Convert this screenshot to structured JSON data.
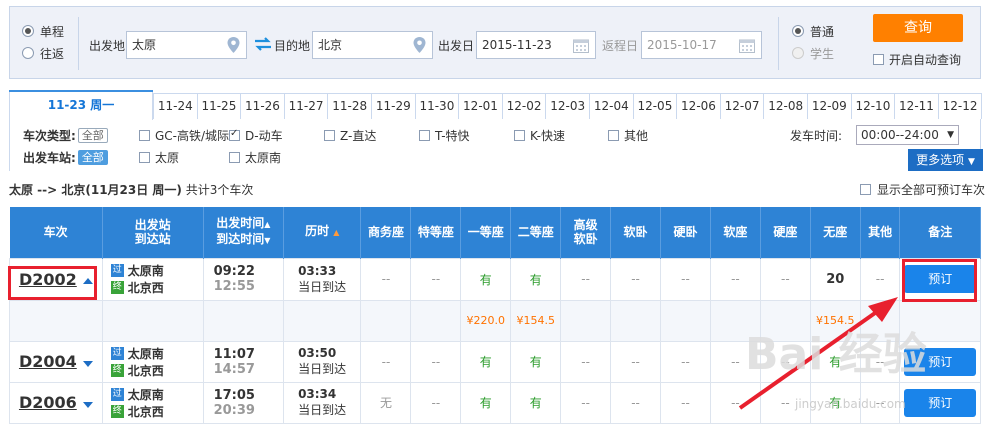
{
  "search": {
    "trip_types": [
      {
        "label": "单程",
        "checked": true
      },
      {
        "label": "往返",
        "checked": false
      }
    ],
    "from_label": "出发地",
    "from_value": "太原",
    "to_label": "目的地",
    "to_value": "北京",
    "depart_label": "出发日",
    "depart_value": "2015-11-23",
    "return_label": "返程日",
    "return_value": "2015-10-17",
    "passenger_types": [
      {
        "label": "普通",
        "checked": true
      },
      {
        "label": "学生",
        "checked": false
      }
    ],
    "query_label": "查询",
    "auto_query_label": "开启自动查询"
  },
  "dates": {
    "active": "11-23 周一",
    "tabs": [
      "11-24",
      "11-25",
      "11-26",
      "11-27",
      "11-28",
      "11-29",
      "11-30",
      "12-01",
      "12-02",
      "12-03",
      "12-04",
      "12-05",
      "12-06",
      "12-07",
      "12-08",
      "12-09",
      "12-10",
      "12-11",
      "12-12"
    ]
  },
  "filters": {
    "type_label": "车次类型:",
    "all_label": "全部",
    "types": [
      {
        "label": "GC-高铁/城际",
        "checked": false
      },
      {
        "label": "D-动车",
        "checked": true
      },
      {
        "label": "Z-直达",
        "checked": false
      },
      {
        "label": "T-特快",
        "checked": false
      },
      {
        "label": "K-快速",
        "checked": false
      },
      {
        "label": "其他",
        "checked": false
      }
    ],
    "station_label": "出发车站:",
    "stations": [
      {
        "label": "太原",
        "checked": false
      },
      {
        "label": "太原南",
        "checked": false
      }
    ],
    "time_label": "发车时间:",
    "time_value": "00:00--24:00",
    "more_label": "更多选项"
  },
  "summary": {
    "route": "太原 --> 北京",
    "date": "(11月23日  周一)",
    "count_text": "共计3个车次",
    "show_all_label": "显示全部可预订车次"
  },
  "table": {
    "headers": {
      "train": "车次",
      "station_1": "出发站",
      "station_2": "到达站",
      "time_1": "出发时间",
      "time_2": "到达时间",
      "duration": "历时",
      "business": "商务座",
      "special": "特等座",
      "first": "一等座",
      "second": "二等座",
      "senior_1": "高级",
      "senior_2": "软卧",
      "soft_sleeper": "软卧",
      "hard_sleeper": "硬卧",
      "soft_seat": "软座",
      "hard_seat": "硬座",
      "no_seat": "无座",
      "other": "其他",
      "note": "备注"
    },
    "rows": [
      {
        "train": "D2002",
        "from_badge": "过",
        "from": "太原南",
        "to_badge": "终",
        "to": "北京西",
        "depart": "09:22",
        "arrive": "12:55",
        "duration": "03:33",
        "arrive_day": "当日到达",
        "business": "--",
        "special": "--",
        "first": "有",
        "second": "有",
        "senior": "--",
        "soft_sleeper": "--",
        "hard_sleeper": "--",
        "soft_seat": "--",
        "hard_seat": "--",
        "no_seat": "20",
        "other": "--",
        "book": "预订",
        "prices": {
          "first": "¥220.0",
          "second": "¥154.5",
          "no_seat": "¥154.5"
        }
      },
      {
        "train": "D2004",
        "from_badge": "过",
        "from": "太原南",
        "to_badge": "终",
        "to": "北京西",
        "depart": "11:07",
        "arrive": "14:57",
        "duration": "03:50",
        "arrive_day": "当日到达",
        "business": "--",
        "special": "--",
        "first": "有",
        "second": "有",
        "senior": "--",
        "soft_sleeper": "--",
        "hard_sleeper": "--",
        "soft_seat": "--",
        "hard_seat": "--",
        "no_seat": "有",
        "other": "--",
        "book": "预订"
      },
      {
        "train": "D2006",
        "from_badge": "过",
        "from": "太原南",
        "to_badge": "终",
        "to": "北京西",
        "depart": "17:05",
        "arrive": "20:39",
        "duration": "03:34",
        "arrive_day": "当日到达",
        "business": "无",
        "special": "--",
        "first": "有",
        "second": "有",
        "senior": "--",
        "soft_sleeper": "--",
        "hard_sleeper": "--",
        "soft_seat": "--",
        "hard_seat": "--",
        "no_seat": "有",
        "other": "--",
        "book": "预订"
      }
    ]
  },
  "watermark": {
    "text": "Bai 经验",
    "url": "jingyan.baidu.com"
  },
  "colors": {
    "accent": "#2e83d5",
    "query": "#ff8000",
    "book": "#1a84ea",
    "annotation": "#e8202e",
    "price": "#ff7200",
    "available": "#2a9b2a"
  }
}
